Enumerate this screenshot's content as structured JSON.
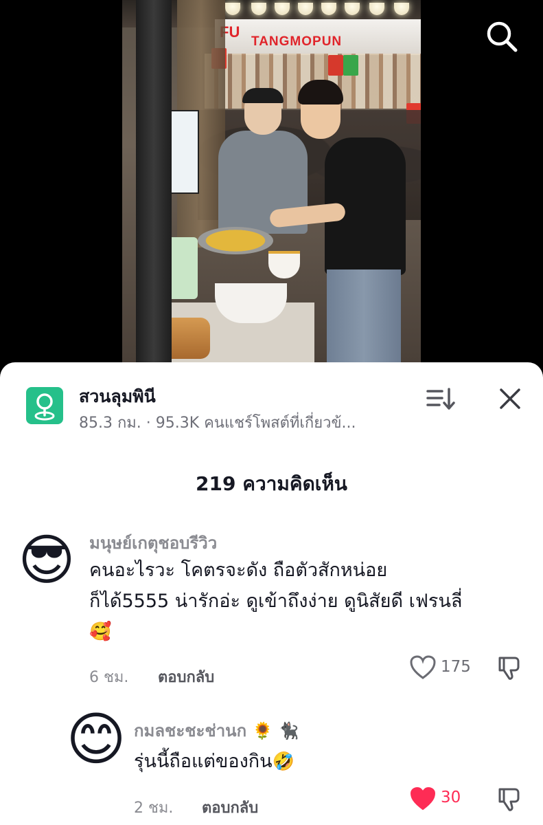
{
  "video": {
    "sign_fu": "FU",
    "sign_text": "TANGMOPUN"
  },
  "sheet": {
    "location_name": "สวนลุมพินี",
    "location_sub": "85.3 กม. · 95.3K คนแชร์โพสต์ที่เกี่ยวข้...",
    "comment_count": "219 ความคิดเห็น"
  },
  "comments": [
    {
      "username": "มนุษย์เกตุชอบรีวิว",
      "text_line1": "คนอะไรวะ โคตรจะดัง ถือตัวสักหน่อย",
      "text_line2": "ก็ได้5555 น่ารักอ่ะ ดูเข้าถึงง่าย ดูนิสัยดี เฟรนลี่",
      "text_emoji": "🥰",
      "avatar_emoji": "😎",
      "time": "6 ชม.",
      "reply": "ตอบกลับ",
      "likes": "175",
      "liked": false
    },
    {
      "username": "กมลชะชะช่านก",
      "username_emoji": "🌻 🐈‍⬛",
      "text": "รุ่นนี้ถือแต่ของกิน",
      "text_emoji": "🤣",
      "avatar_emoji": "😊",
      "time": "2 ชม.",
      "reply": "ตอบกลับ",
      "likes": "30",
      "liked": true
    }
  ],
  "colors": {
    "like_active": "#fe2c55",
    "location_icon_bg": "#25c08a",
    "text_primary": "#161823",
    "text_secondary": "#8a8b91"
  },
  "icons": [
    "search-icon",
    "map-pin-icon",
    "sort-icon",
    "close-icon",
    "heart-icon",
    "dislike-icon"
  ]
}
